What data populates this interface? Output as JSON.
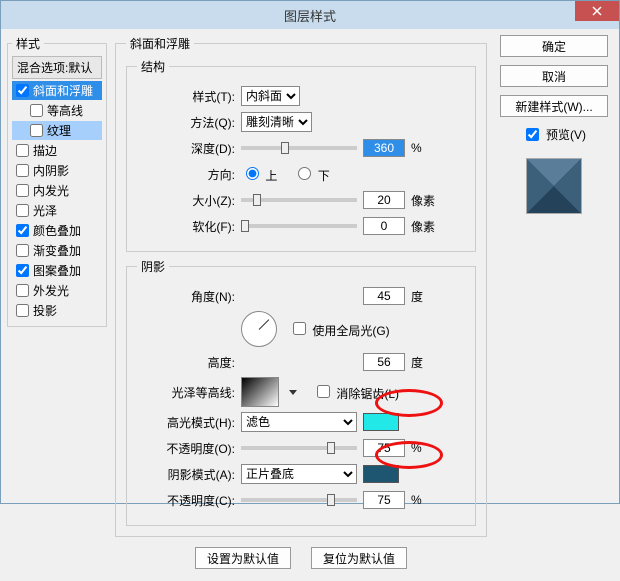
{
  "title": "图层样式",
  "buttons": {
    "ok": "确定",
    "cancel": "取消",
    "newstyle": "新建样式(W)...",
    "preview": "预览(V)",
    "setdefault": "设置为默认值",
    "resetdefault": "复位为默认值"
  },
  "left": {
    "styles_label": "样式",
    "blend_label": "混合选项:默认",
    "items": [
      {
        "label": "斜面和浮雕",
        "checked": true
      },
      {
        "label": "等高线",
        "checked": false
      },
      {
        "label": "纹理",
        "checked": false
      },
      {
        "label": "描边",
        "checked": false
      },
      {
        "label": "内阴影",
        "checked": false
      },
      {
        "label": "内发光",
        "checked": false
      },
      {
        "label": "光泽",
        "checked": false
      },
      {
        "label": "颜色叠加",
        "checked": true
      },
      {
        "label": "渐变叠加",
        "checked": false
      },
      {
        "label": "图案叠加",
        "checked": true
      },
      {
        "label": "外发光",
        "checked": false
      },
      {
        "label": "投影",
        "checked": false
      }
    ]
  },
  "structure": {
    "group_title": "斜面和浮雕",
    "sub_title": "结构",
    "style_label": "样式(T):",
    "style_value": "内斜面",
    "method_label": "方法(Q):",
    "method_value": "雕刻清晰",
    "depth_label": "深度(D):",
    "depth_value": "360",
    "depth_unit": "%",
    "direction_label": "方向:",
    "up": "上",
    "down": "下",
    "size_label": "大小(Z):",
    "size_value": "20",
    "size_unit": "像素",
    "soften_label": "软化(F):",
    "soften_value": "0",
    "soften_unit": "像素"
  },
  "shading": {
    "title": "阴影",
    "angle_label": "角度(N):",
    "angle_value": "45",
    "angle_unit": "度",
    "global_label": "使用全局光(G)",
    "alt_label": "高度:",
    "alt_value": "56",
    "alt_unit": "度",
    "gloss_label": "光泽等高线:",
    "antialias": "消除锯齿(L)",
    "hl_mode_label": "高光模式(H):",
    "hl_mode_value": "滤色",
    "hl_color": "#22e8e8",
    "hl_opacity_label": "不透明度(O):",
    "hl_opacity_value": "75",
    "hl_opacity_unit": "%",
    "sh_mode_label": "阴影模式(A):",
    "sh_mode_value": "正片叠底",
    "sh_color": "#1e5570",
    "sh_opacity_label": "不透明度(C):",
    "sh_opacity_value": "75",
    "sh_opacity_unit": "%"
  }
}
